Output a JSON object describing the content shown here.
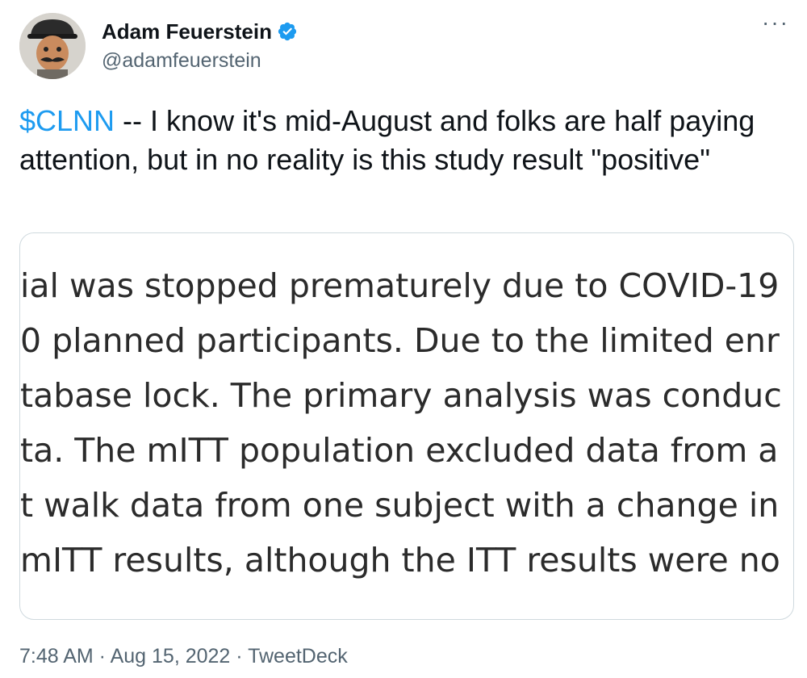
{
  "author": {
    "name": "Adam Feuerstein",
    "handle": "@adamfeuerstein",
    "verified": true,
    "avatar_icon": "avatar-icon"
  },
  "menu": {
    "more_label": "···"
  },
  "tweet": {
    "cashtag": "$CLNN",
    "text": " -- I know it's mid-August and folks are half paying attention, but in no reality is this study result \"positive\""
  },
  "image_text": {
    "lines": [
      "ial was stopped prematurely due to COVID-19",
      "0 planned participants. Due to the limited enr",
      "tabase lock. The primary analysis was conduc",
      "ta. The mITT population excluded data from a",
      "t walk data from one subject with a change in",
      "mITT results, although the ITT results were no"
    ]
  },
  "meta": {
    "time": "7:48 AM",
    "separator": " · ",
    "date": "Aug 15, 2022",
    "source": "TweetDeck"
  },
  "colors": {
    "link": "#1d9bf0",
    "secondary_text": "#536471",
    "primary_text": "#0f1419",
    "border": "#cfd9de"
  }
}
